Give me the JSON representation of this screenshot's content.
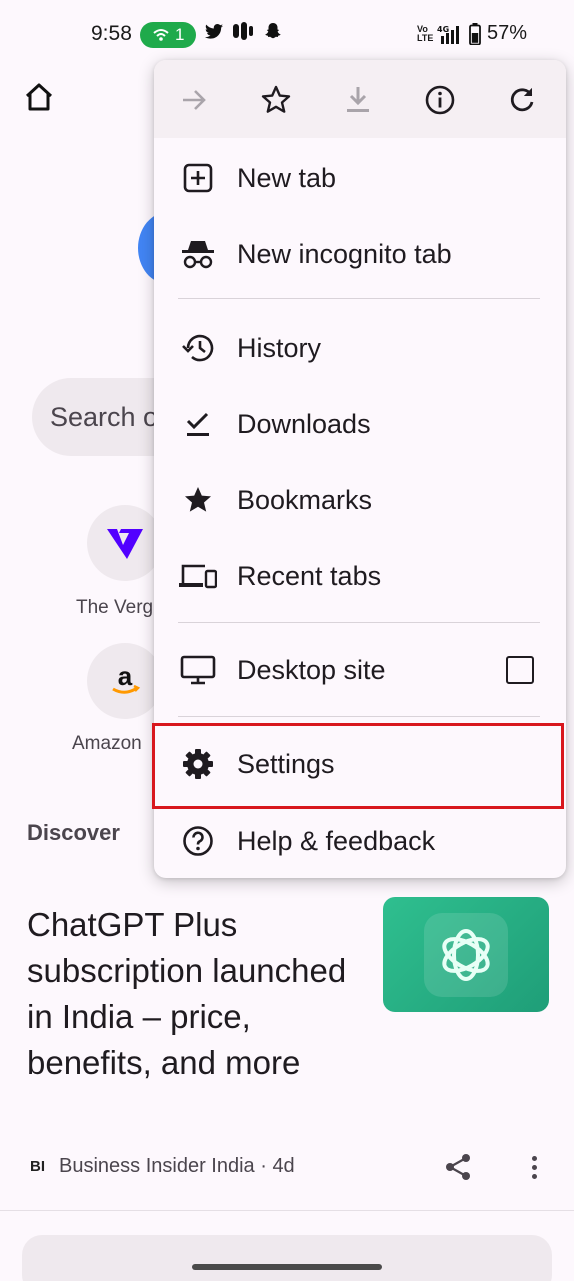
{
  "status_bar": {
    "time": "9:58",
    "hotspot_count": "1",
    "battery_percent": "57%",
    "network": "4G",
    "volte": "Vo LTE"
  },
  "page": {
    "search_placeholder": "Search o",
    "shortcuts": [
      {
        "label": "The Verg",
        "icon": "verge-logo-icon"
      },
      {
        "label": "Amazon",
        "icon": "amazon-logo-icon"
      }
    ],
    "discover_label": "Discover",
    "article": {
      "title": "ChatGPT Plus subscription launched in India – price, benefits, and more",
      "source_logo": "BI",
      "source": "Business Insider India · 4d"
    }
  },
  "menu": {
    "toolbar": [
      {
        "icon": "forward-arrow-icon",
        "enabled": false
      },
      {
        "icon": "star-outline-icon",
        "enabled": true
      },
      {
        "icon": "download-icon",
        "enabled": false
      },
      {
        "icon": "info-icon",
        "enabled": true
      },
      {
        "icon": "refresh-icon",
        "enabled": true
      }
    ],
    "items": {
      "new_tab": "New tab",
      "new_incognito_tab": "New incognito tab",
      "history": "History",
      "downloads": "Downloads",
      "bookmarks": "Bookmarks",
      "recent_tabs": "Recent tabs",
      "desktop_site": "Desktop site",
      "settings": "Settings",
      "help_feedback": "Help & feedback"
    },
    "desktop_site_checked": false
  },
  "colors": {
    "accent_highlight": "#d8171d",
    "hotspot_green": "#1faa4b",
    "thumb_teal": "#2fbf8f"
  }
}
